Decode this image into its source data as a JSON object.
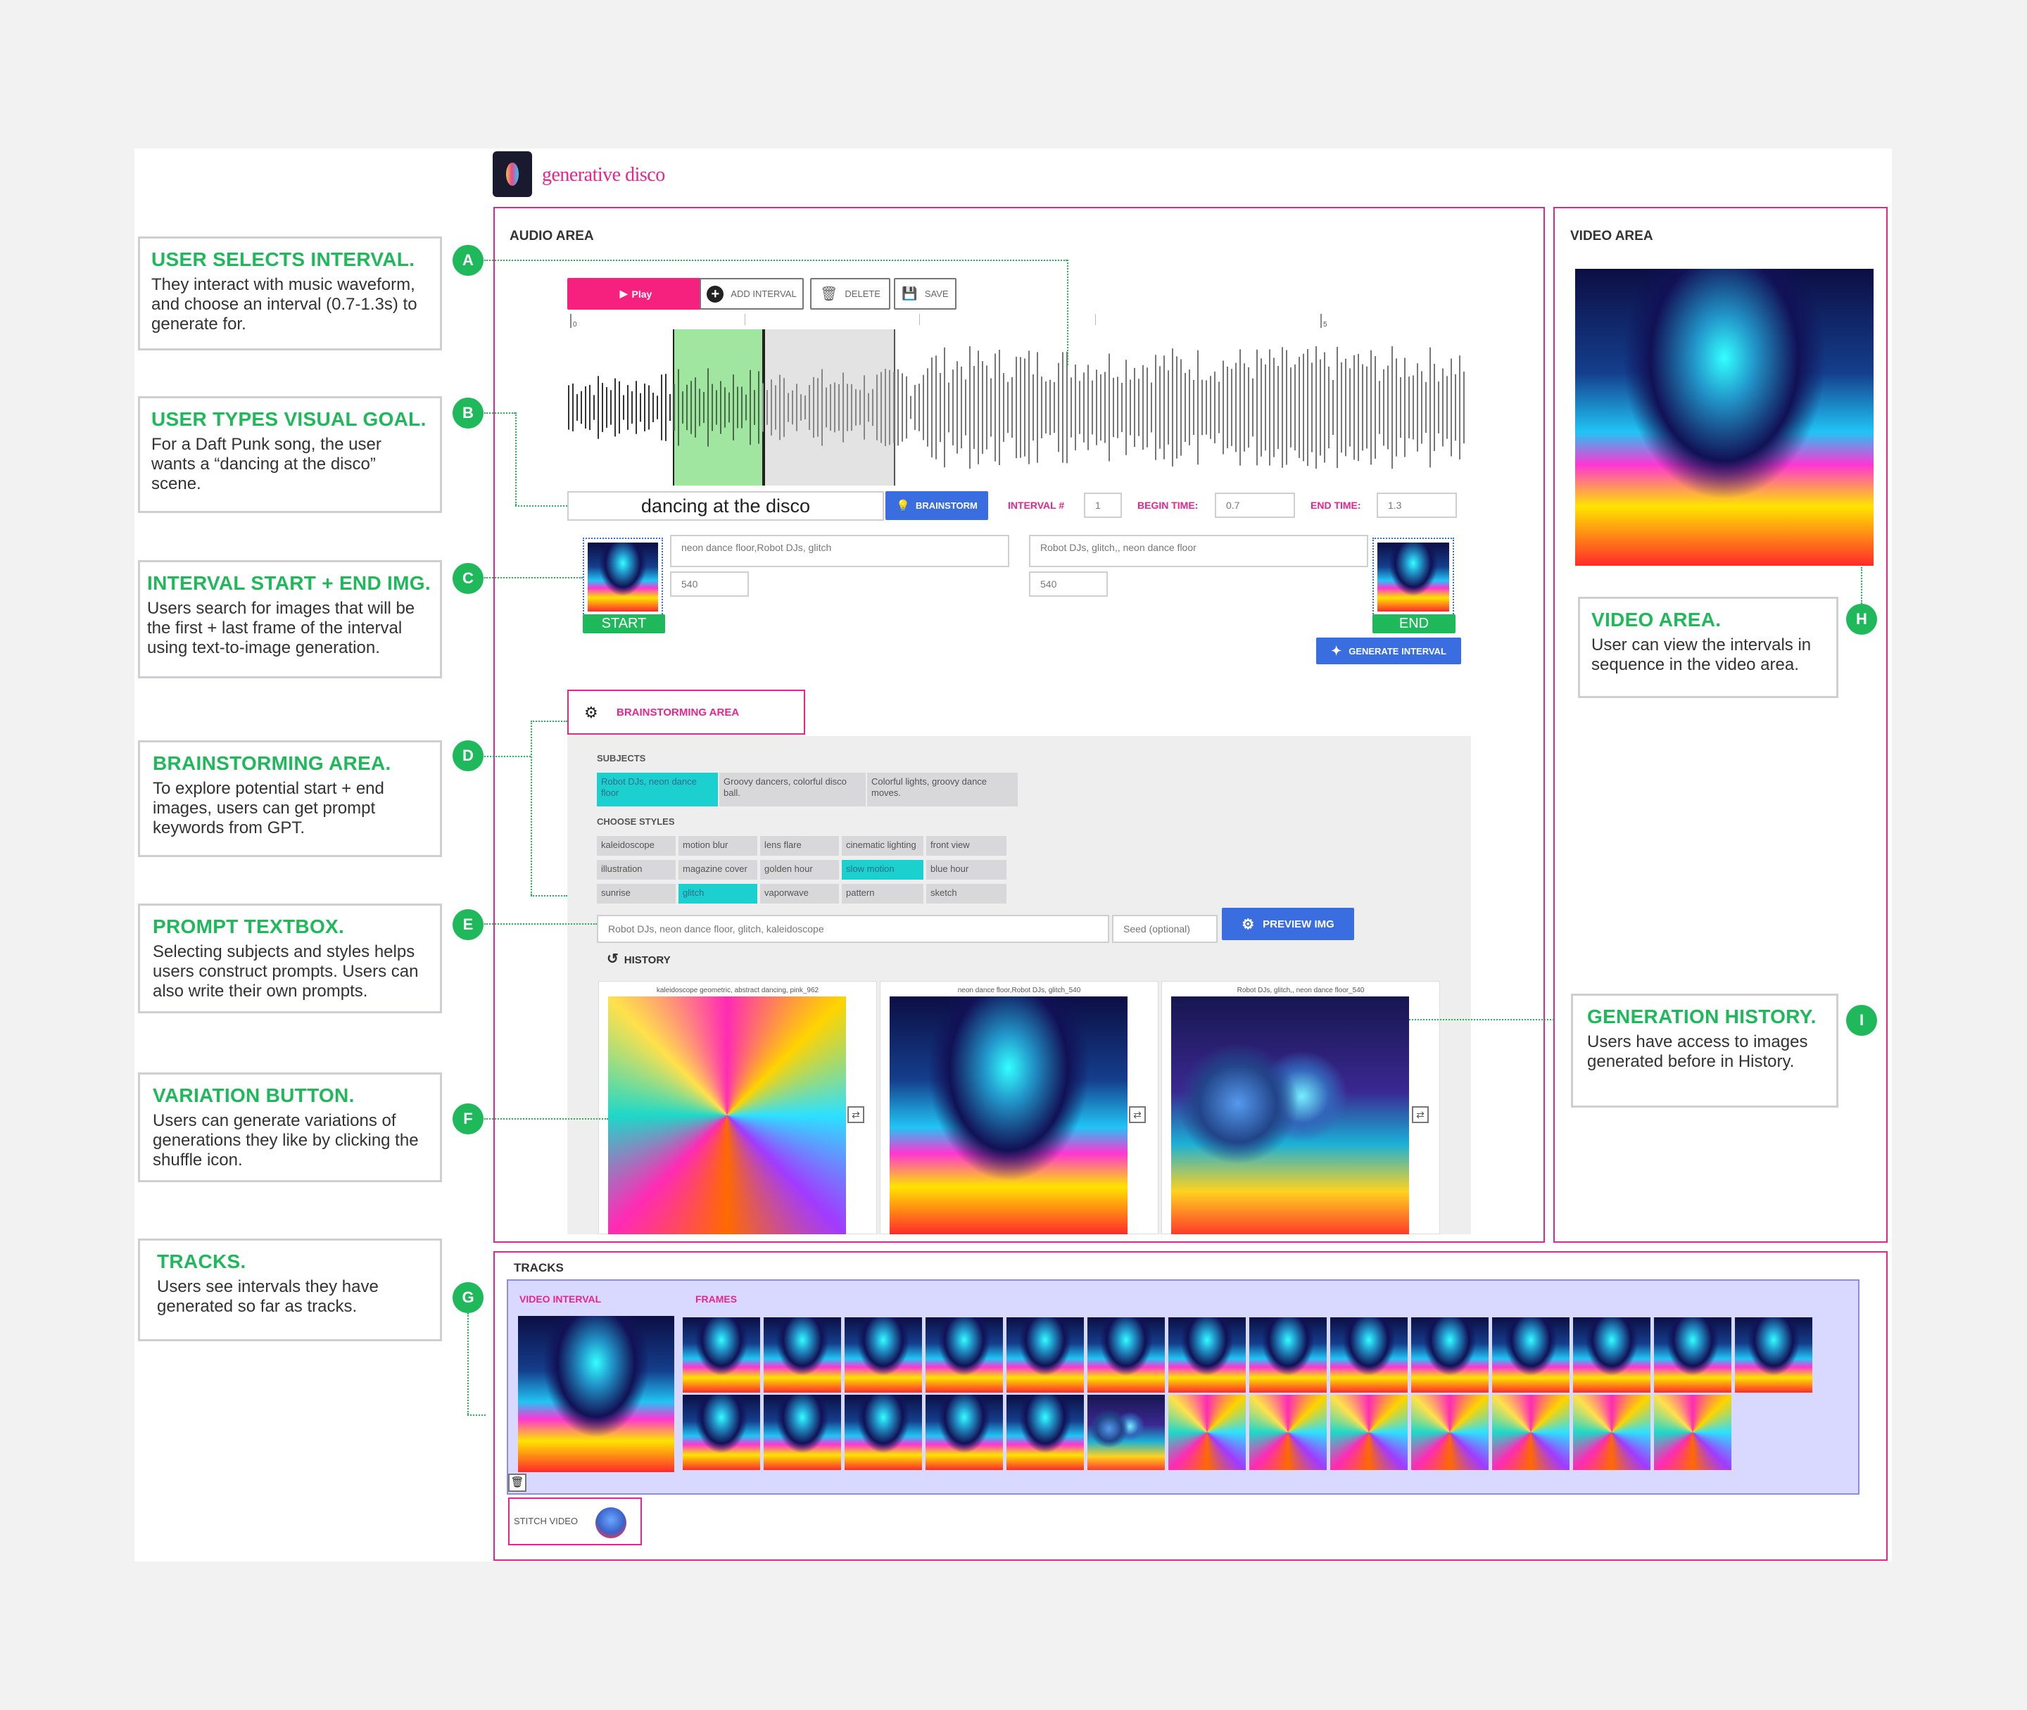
{
  "app": {
    "title": "generative disco"
  },
  "audio": {
    "title": "AUDIO AREA",
    "play_label": "Play",
    "add_label": "ADD INTERVAL",
    "delete_label": "DELETE",
    "save_label": "SAVE",
    "tick_start": "0",
    "tick_mid": "5",
    "goal_value": "dancing at the disco",
    "brainstorm_label": "BRAINSTORM",
    "interval_label": "INTERVAL #",
    "interval_value": "1",
    "begin_label": "BEGIN TIME:",
    "begin_value": "0.7",
    "end_label": "END TIME:",
    "end_value": "1.3",
    "start_prompt": "neon dance floor,Robot DJs, glitch",
    "start_seed": "540",
    "end_prompt": "Robot DJs, glitch,, neon dance floor",
    "end_seed": "540",
    "start_label": "START",
    "end_tag": "END",
    "generate_label": "GENERATE INTERVAL"
  },
  "brainstorm": {
    "tab_label": "BRAINSTORMING AREA",
    "subjects_label": "SUBJECTS",
    "subjects": [
      "Robot DJs, neon dance floor",
      "Groovy dancers, colorful disco ball.",
      "Colorful lights, groovy dance moves."
    ],
    "styles_label": "CHOOSE STYLES",
    "styles": [
      "kaleidoscope",
      "motion blur",
      "lens flare",
      "cinematic lighting",
      "front view",
      "illustration",
      "magazine cover",
      "golden hour",
      "slow motion",
      "blue hour",
      "sunrise",
      "glitch",
      "vaporwave",
      "pattern",
      "sketch"
    ],
    "prompt_value": "Robot DJs, neon dance floor, glitch, kaleidoscope",
    "seed_placeholder": "Seed (optional)",
    "preview_label": "PREVIEW IMG",
    "history_label": "HISTORY",
    "history": [
      "kaleidoscope geometric, abstract dancing, pink_962",
      "neon dance floor,Robot DJs, glitch_540",
      "Robot DJs, glitch,, neon dance floor_540"
    ]
  },
  "video": {
    "title": "VIDEO AREA"
  },
  "tracks": {
    "title": "TRACKS",
    "video_interval_label": "VIDEO INTERVAL",
    "frames_label": "FRAMES",
    "stitch_label": "STITCH VIDEO"
  },
  "notes": {
    "A": {
      "badge": "A",
      "title": "USER SELECTS INTERVAL.",
      "text": "They interact with music waveform, and choose an interval (0.7-1.3s) to generate for."
    },
    "B": {
      "badge": "B",
      "title": "USER TYPES VISUAL GOAL.",
      "text": "For a Daft Punk song, the user wants a “dancing at the disco” scene."
    },
    "C": {
      "badge": "C",
      "title": "INTERVAL START + END IMG.",
      "text": "Users search for images that will be the first + last frame of the interval using text-to-image generation."
    },
    "D": {
      "badge": "D",
      "title": "BRAINSTORMING AREA.",
      "text": "To explore potential start + end images, users can get prompt keywords from GPT."
    },
    "E": {
      "badge": "E",
      "title": "PROMPT TEXTBOX.",
      "text": "Selecting subjects and styles helps users construct prompts. Users can also write their own prompts."
    },
    "F": {
      "badge": "F",
      "title": "VARIATION BUTTON.",
      "text": "Users can generate variations of generations they like by clicking the shuffle icon."
    },
    "G": {
      "badge": "G",
      "title": "TRACKS.",
      "text": "Users see intervals they have generated so far as tracks."
    },
    "H": {
      "badge": "H",
      "title": "VIDEO AREA.",
      "text": "User can view the intervals in sequence in the video area."
    },
    "I": {
      "badge": "I",
      "title": "GENERATION HISTORY.",
      "text": "Users have access to images generated before in History."
    }
  },
  "colors": {
    "accent": "#e8258e",
    "annotation": "#1fb85a",
    "action": "#3a6ee0",
    "selected": "#1dd0d0"
  }
}
